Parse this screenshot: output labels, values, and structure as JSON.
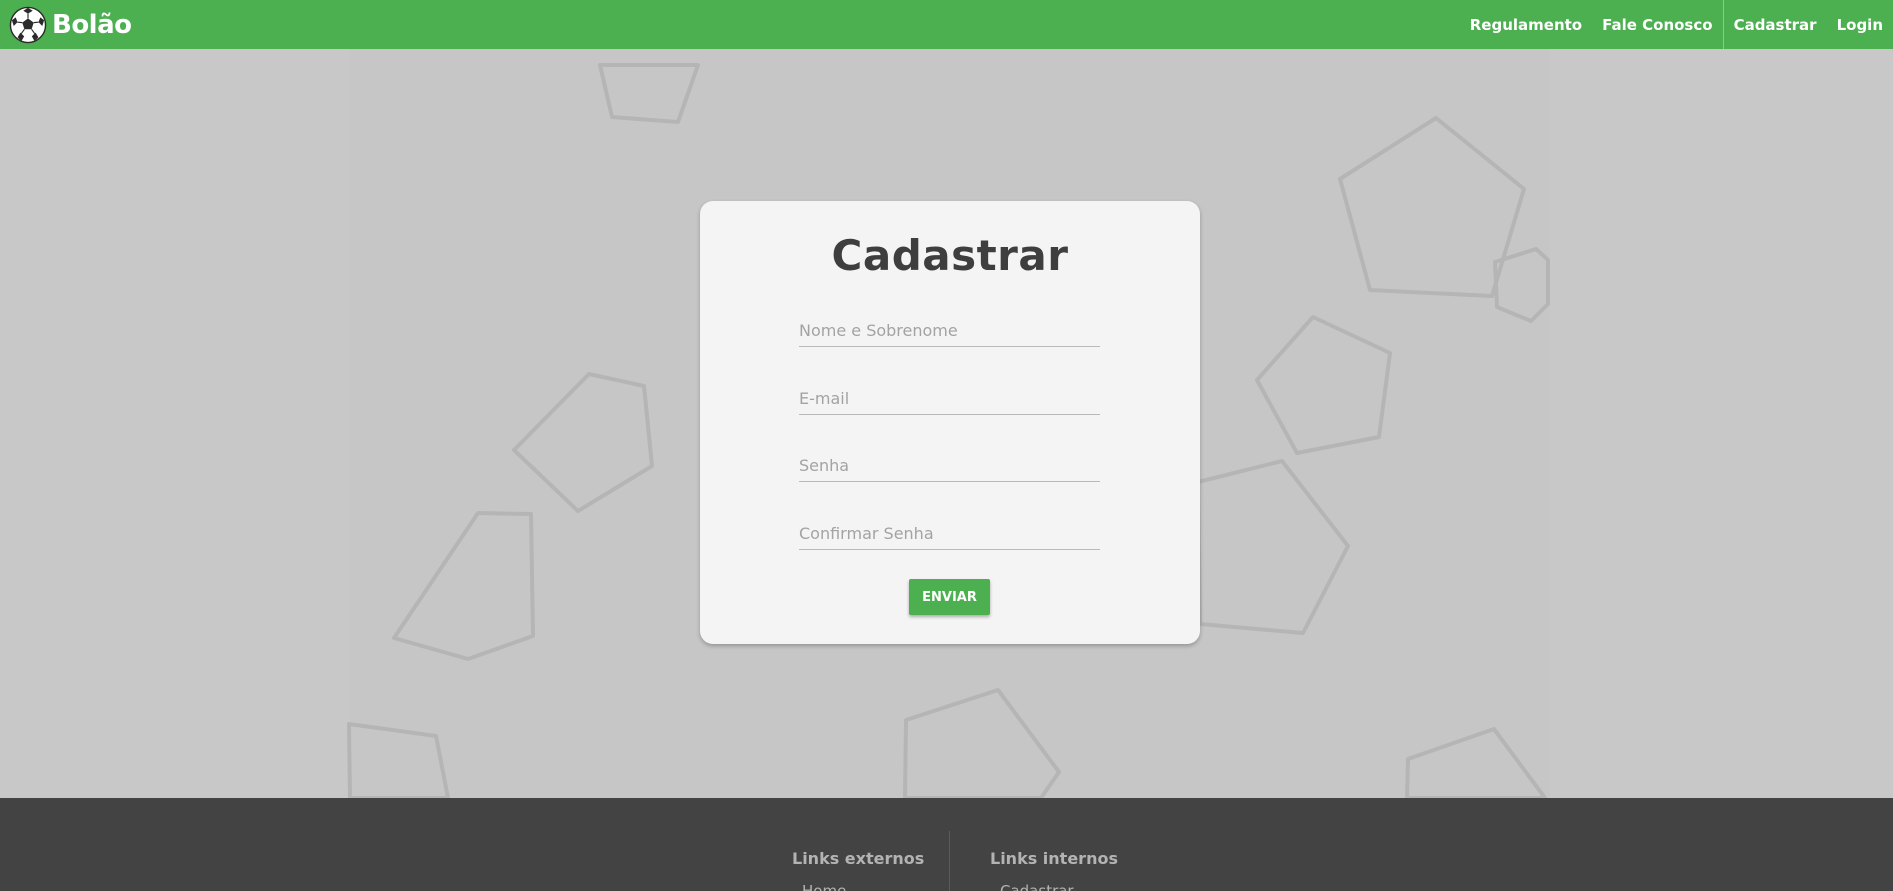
{
  "header": {
    "brand_name": "Bolão",
    "brand_icon": "soccer-ball-icon",
    "nav": [
      {
        "label": "Regulamento"
      },
      {
        "label": "Fale Conosco"
      },
      {
        "label": "Cadastrar"
      },
      {
        "label": "Login"
      }
    ]
  },
  "form": {
    "title": "Cadastrar",
    "fields": {
      "name_placeholder": "Nome e Sobrenome",
      "email_placeholder": "E-mail",
      "password_placeholder": "Senha",
      "confirm_placeholder": "Confirmar Senha"
    },
    "submit_label": "ENVIAR"
  },
  "footer": {
    "external": {
      "heading": "Links externos",
      "links": [
        "Home"
      ]
    },
    "internal": {
      "heading": "Links internos",
      "links": [
        "Cadastrar"
      ]
    }
  },
  "colors": {
    "primary": "#4caf50",
    "background": "#c8c8c8",
    "card": "#f4f4f4",
    "footer": "#434343",
    "title_text": "#3e3e3e"
  }
}
